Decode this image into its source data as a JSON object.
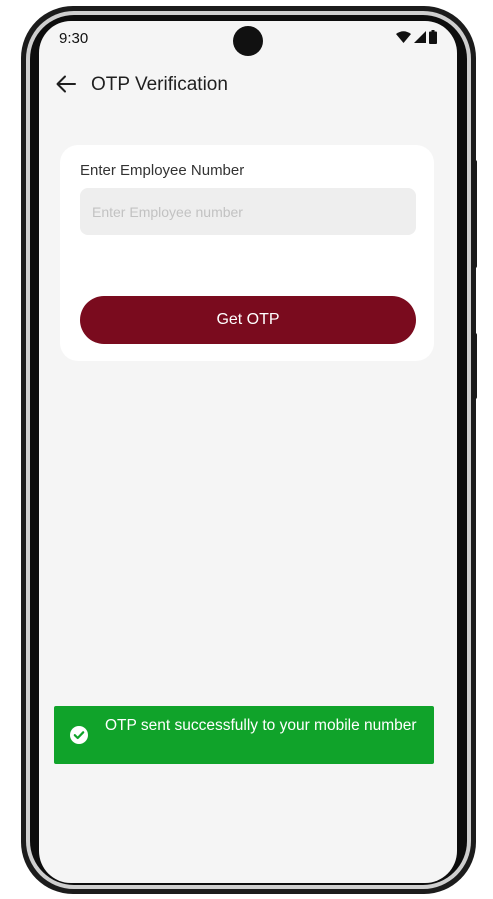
{
  "status_bar": {
    "time": "9:30"
  },
  "app_bar": {
    "title": "OTP Verification",
    "back_icon": "arrow-left-icon"
  },
  "form": {
    "field_label": "Enter Employee Number",
    "employee_input": {
      "value": "",
      "placeholder": "Enter Employee number"
    },
    "submit_label": "Get OTP"
  },
  "toast": {
    "message": "OTP sent successfully to your mobile number",
    "icon": "check-circle-icon"
  },
  "colors": {
    "primary": "#7a0b1e",
    "success": "#10a32a",
    "background": "#f5f5f5",
    "card": "#ffffff",
    "input_bg": "#eeeeee"
  }
}
